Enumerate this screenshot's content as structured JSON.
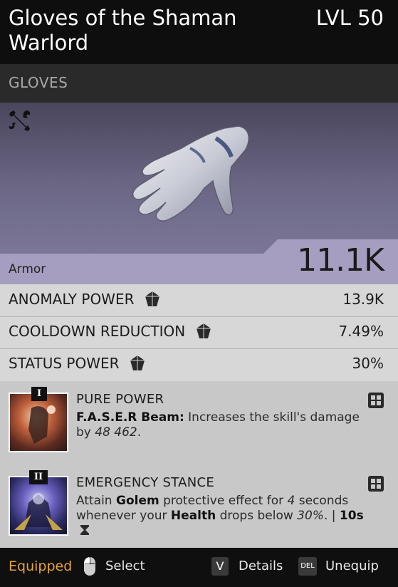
{
  "item": {
    "name": "Gloves of the Shaman Warlord",
    "level": "LVL 50",
    "type": "GLOVES",
    "tool_icon": "crossed-tools-icon",
    "armor_label": "Armor",
    "armor_value": "11.1K"
  },
  "stats": [
    {
      "name": "ANOMALY POWER",
      "icon": "gem-icon",
      "value": "13.9K"
    },
    {
      "name": "COOLDOWN REDUCTION",
      "icon": "gem-icon",
      "value": "7.49%"
    },
    {
      "name": "STATUS POWER",
      "icon": "gem-icon",
      "value": "30%"
    }
  ],
  "mods": [
    {
      "tier": "I",
      "title": "PURE POWER",
      "desc_bold": "F.A.S.E.R Beam:",
      "desc_text": " Increases the skill's damage by ",
      "desc_value": "48 462",
      "desc_end": "."
    },
    {
      "tier": "II",
      "title": "EMERGENCY STANCE",
      "p1": "Attain ",
      "b1": "Golem",
      "p2": " protective effect for ",
      "i1": "4",
      "p3": " seconds whenever your ",
      "b2": "Health",
      "p4": " drops below ",
      "i2": "30%",
      "p5": ". | ",
      "b3": "10s"
    }
  ],
  "footer": {
    "status": "Equipped",
    "select_label": "Select",
    "details_key": "V",
    "details_label": "Details",
    "unequip_key": "DEL",
    "unequip_label": "Unequip"
  },
  "colors": {
    "accent_equipped": "#e6a23a",
    "armor_band": "#a59ec0"
  }
}
